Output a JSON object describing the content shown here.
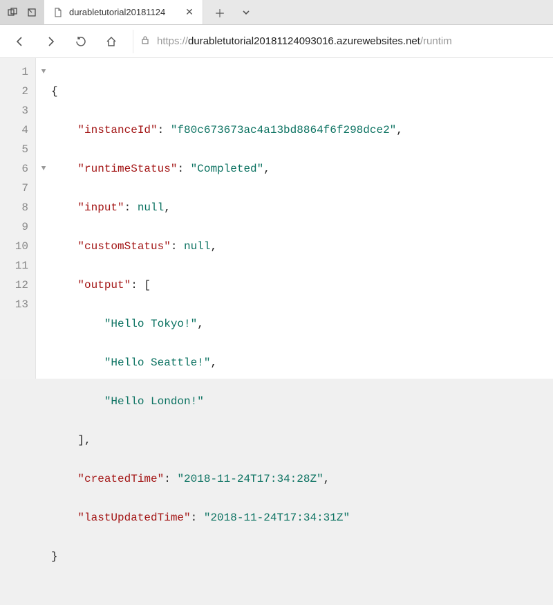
{
  "titlebar": {
    "tab_title": "durabletutorial20181124"
  },
  "addrbar": {
    "scheme": "https://",
    "host": "durabletutorial20181124093016.azurewebsites.net",
    "path": "/runtim"
  },
  "code": {
    "lines": [
      "1",
      "2",
      "3",
      "4",
      "5",
      "6",
      "7",
      "8",
      "9",
      "10",
      "11",
      "12",
      "13"
    ],
    "k_instanceId": "\"instanceId\"",
    "v_instanceId": "\"f80c673673ac4a13bd8864f6f298dce2\"",
    "k_runtimeStatus": "\"runtimeStatus\"",
    "v_runtimeStatus": "\"Completed\"",
    "k_input": "\"input\"",
    "v_null": "null",
    "k_customStatus": "\"customStatus\"",
    "k_output": "\"output\"",
    "v_out1": "\"Hello Tokyo!\"",
    "v_out2": "\"Hello Seattle!\"",
    "v_out3": "\"Hello London!\"",
    "k_createdTime": "\"createdTime\"",
    "v_createdTime": "\"2018-11-24T17:34:28Z\"",
    "k_lastUpdatedTime": "\"lastUpdatedTime\"",
    "v_lastUpdatedTime": "\"2018-11-24T17:34:31Z\""
  }
}
